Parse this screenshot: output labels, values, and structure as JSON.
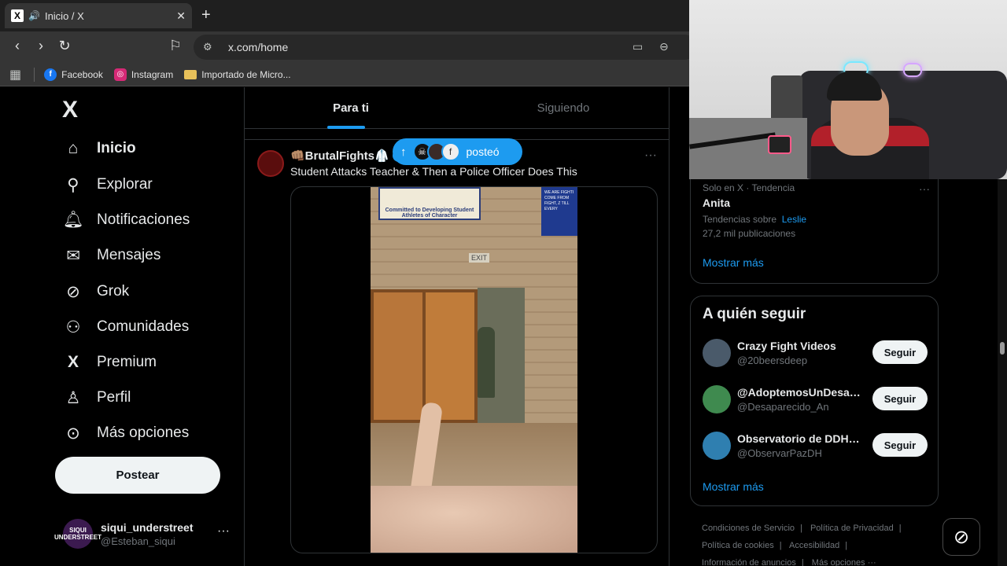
{
  "browser": {
    "tab_title": "Inicio / X",
    "favicon": "X",
    "url": "x.com/home",
    "bookmarks": [
      {
        "label": "Facebook",
        "icon": "facebook-icon",
        "color": "#1877f2"
      },
      {
        "label": "Instagram",
        "icon": "instagram-icon",
        "color": "#d62976"
      },
      {
        "label": "Importado de Micro...",
        "icon": "folder-icon",
        "color": "#e8c15a"
      }
    ]
  },
  "sidebar": {
    "logo": "X",
    "items": [
      {
        "label": "Inicio",
        "icon": "home-icon",
        "glyph": "⌂"
      },
      {
        "label": "Explorar",
        "icon": "search-icon",
        "glyph": "⌕"
      },
      {
        "label": "Notificaciones",
        "icon": "bell-icon",
        "glyph": "♫"
      },
      {
        "label": "Mensajes",
        "icon": "mail-icon",
        "glyph": "✉"
      },
      {
        "label": "Grok",
        "icon": "grok-icon",
        "glyph": "⊘"
      },
      {
        "label": "Comunidades",
        "icon": "communities-icon",
        "glyph": "♟"
      },
      {
        "label": "Premium",
        "icon": "x-premium-icon",
        "glyph": "X"
      },
      {
        "label": "Perfil",
        "icon": "profile-icon",
        "glyph": "♙"
      },
      {
        "label": "Más opciones",
        "icon": "more-circle-icon",
        "glyph": "⋯"
      }
    ],
    "post_button": "Postear",
    "account": {
      "display_name": "siqui_understreet",
      "username": "@Esteban_siqui",
      "avatar_text": "SIQUI UNDERSTREET"
    }
  },
  "timeline": {
    "tabs": [
      "Para ti",
      "Siguiendo"
    ],
    "new_posts_pill": "posteó",
    "post": {
      "author": "👊🏽BrutalFights🥼",
      "text": "Student Attacks Teacher & Then a Police Officer Does This",
      "video_banner": "Committed to Developing Student Athletes of Character",
      "video_sign": "WE ARE FIGHTI COME FROM FIGHT, Z TILL EVERY",
      "video_exit": "EXIT"
    }
  },
  "right": {
    "trend": {
      "meta": "Solo en X · Tendencia",
      "name": "Anita",
      "about_prefix": "Tendencias sobre",
      "about_link": "Leslie",
      "count": "27,2 mil publicaciones"
    },
    "show_more": "Mostrar más",
    "who_to_follow": {
      "title": "A quién seguir",
      "follow_label": "Seguir",
      "accounts": [
        {
          "name": "Crazy Fight Videos",
          "handle": "@20beersdeep",
          "color": "#4a5a6a"
        },
        {
          "name": "@AdoptemosUnDesap...",
          "handle": "@Desaparecido_An",
          "color": "#3f8a4f"
        },
        {
          "name": "Observatorio de DDHH...",
          "handle": "@ObservarPazDH",
          "color": "#2f7fb0"
        }
      ],
      "show_more": "Mostrar más"
    },
    "footer": {
      "links": [
        "Condiciones de Servicio",
        "Política de Privacidad",
        "Política de cookies",
        "Accesibilidad",
        "Información de anuncios",
        "Más opciones ···"
      ]
    }
  },
  "status_url": "https://x.com/i/connect_people?user_id=1552803828818358272"
}
